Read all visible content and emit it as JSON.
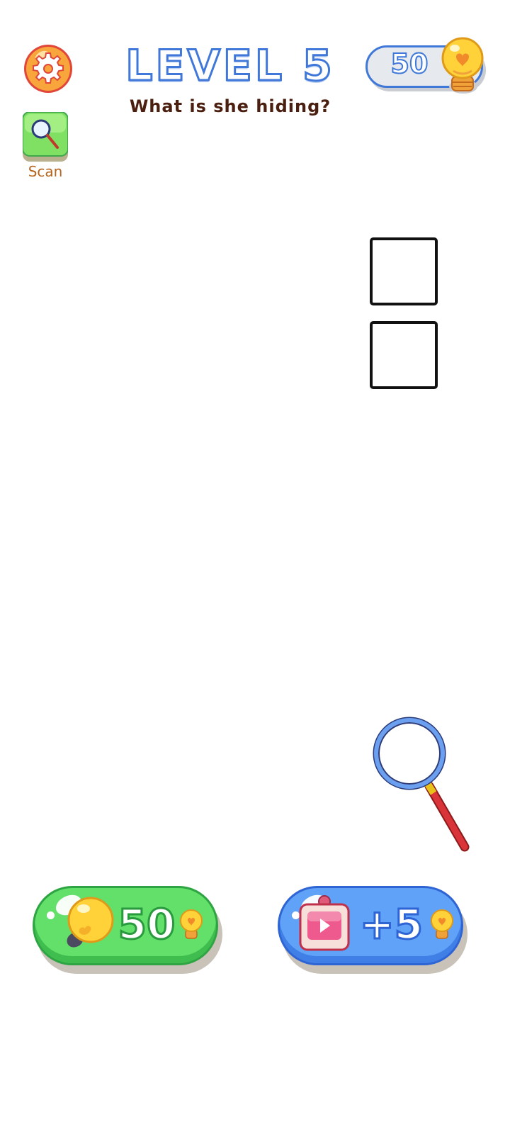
{
  "header": {
    "level_title": "LEVEL 5",
    "question": "What is she hiding?",
    "bulb_count": "50"
  },
  "tools": {
    "scan_label": "Scan"
  },
  "answer_slots": [
    {
      "value": ""
    },
    {
      "value": ""
    }
  ],
  "actions": {
    "hint_cost": "50",
    "ad_reward": "+5"
  },
  "colors": {
    "title_outline": "#3f78d8",
    "hint_button": "#62e06a",
    "ad_button": "#5fa2f7",
    "settings_button": "#f5a33b",
    "scan_button": "#7fe064",
    "bulb": "#ffd23a"
  },
  "icons": [
    "gear-icon",
    "magnifier-icon",
    "lightbulb-icon",
    "video-ad-icon"
  ]
}
